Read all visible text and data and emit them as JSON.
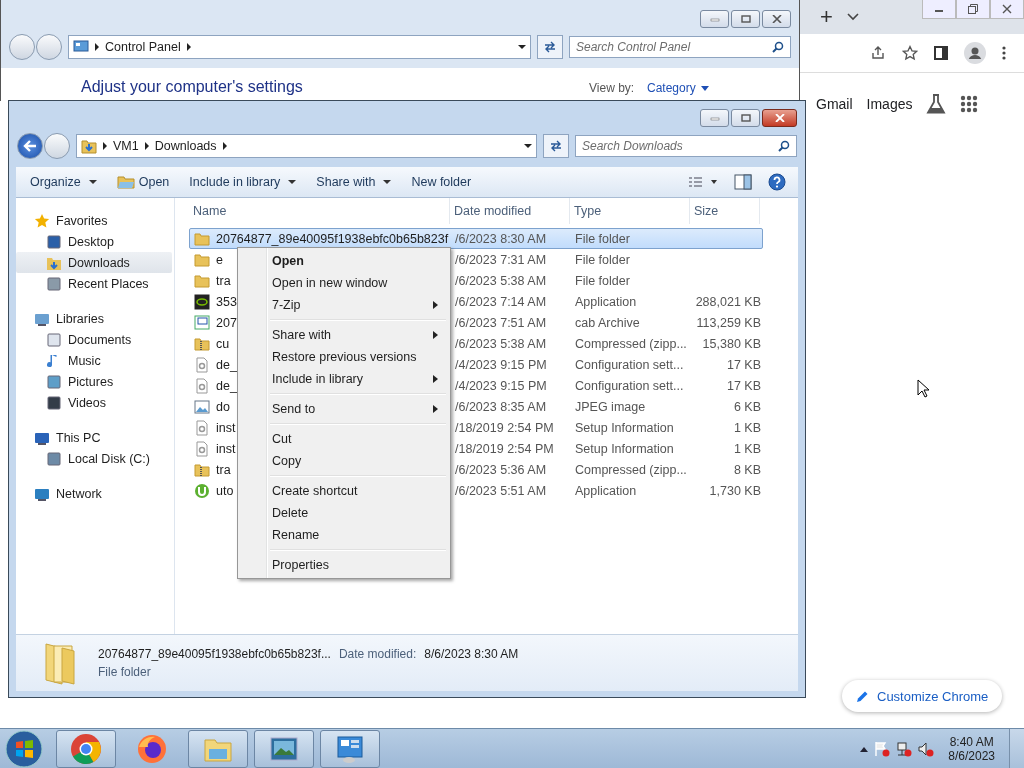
{
  "chrome": {
    "new_tab": "+",
    "links": [
      "Gmail",
      "Images"
    ],
    "customize": "Customize Chrome"
  },
  "control_panel": {
    "breadcrumb": [
      "Control Panel"
    ],
    "search": {
      "placeholder": "Search Control Panel"
    },
    "heading": "Adjust your computer's settings",
    "view_by": "View by:",
    "view_value": "Category"
  },
  "explorer": {
    "breadcrumb": [
      "VM1",
      "Downloads"
    ],
    "search": {
      "placeholder": "Search Downloads"
    },
    "toolbar": [
      {
        "label": "Organize",
        "kind": "menu"
      },
      {
        "label": "Open",
        "kind": "icon"
      },
      {
        "label": "Include in library",
        "kind": "menu"
      },
      {
        "label": "Share with",
        "kind": "menu"
      },
      {
        "label": "New folder",
        "kind": "plain"
      }
    ],
    "nav": [
      {
        "label": "Favorites",
        "kind": "star",
        "selected": false,
        "children": [
          {
            "label": "Desktop",
            "kind": "desktop",
            "selected": false
          },
          {
            "label": "Downloads",
            "kind": "downloads",
            "selected": true
          },
          {
            "label": "Recent Places",
            "kind": "recent",
            "selected": false
          }
        ]
      },
      {
        "label": "Libraries",
        "kind": "library",
        "selected": false,
        "children": [
          {
            "label": "Documents",
            "kind": "document",
            "selected": false
          },
          {
            "label": "Music",
            "kind": "music",
            "selected": false
          },
          {
            "label": "Pictures",
            "kind": "pictures",
            "selected": false
          },
          {
            "label": "Videos",
            "kind": "videos",
            "selected": false
          }
        ]
      },
      {
        "label": "This PC",
        "kind": "pc",
        "selected": false,
        "children": [
          {
            "label": "Local Disk (C:)",
            "kind": "disk",
            "selected": false
          }
        ]
      },
      {
        "label": "Network",
        "kind": "network",
        "selected": false
      }
    ],
    "columns": [
      "Name",
      "Date modified",
      "Type",
      "Size"
    ],
    "rows": [
      {
        "kind": "folder",
        "name": "20764877_89e40095f1938ebfc0b65b823f",
        "date": "/6/2023 8:30 AM",
        "type": "File folder",
        "size": "",
        "selected": true
      },
      {
        "kind": "folder",
        "name": "e",
        "date": "/6/2023 7:31 AM",
        "type": "File folder",
        "size": "",
        "selected": false
      },
      {
        "kind": "folder",
        "name": "tra",
        "date": "/6/2023 5:38 AM",
        "type": "File folder",
        "size": "",
        "selected": false
      },
      {
        "kind": "app",
        "name": "353",
        "date": "/6/2023 7:14 AM",
        "type": "Application",
        "size": "288,021 KB",
        "selected": false
      },
      {
        "kind": "cab",
        "name": "207",
        "date": "/6/2023 7:51 AM",
        "type": "cab Archive",
        "size": "113,259 KB",
        "selected": false
      },
      {
        "kind": "zip",
        "name": "cu",
        "date": "/6/2023 5:38 AM",
        "type": "Compressed (zipp...",
        "size": "15,380 KB",
        "selected": false
      },
      {
        "kind": "config",
        "name": "de_",
        "date": "/4/2023 9:15 PM",
        "type": "Configuration sett...",
        "size": "17 KB",
        "selected": false
      },
      {
        "kind": "config",
        "name": "de_",
        "date": "/4/2023 9:15 PM",
        "type": "Configuration sett...",
        "size": "17 KB",
        "selected": false
      },
      {
        "kind": "image",
        "name": "do",
        "date": "/6/2023 8:35 AM",
        "type": "JPEG image",
        "size": "6 KB",
        "selected": false
      },
      {
        "kind": "config",
        "name": "inst",
        "date": "/18/2019 2:54 PM",
        "type": "Setup Information",
        "size": "1 KB",
        "selected": false
      },
      {
        "kind": "config",
        "name": "inst",
        "date": "/18/2019 2:54 PM",
        "type": "Setup Information",
        "size": "1 KB",
        "selected": false
      },
      {
        "kind": "zip",
        "name": "tra",
        "date": "/6/2023 5:36 AM",
        "type": "Compressed (zipp...",
        "size": "8 KB",
        "selected": false
      },
      {
        "kind": "torrent",
        "name": "uto",
        "date": "/6/2023 5:51 AM",
        "type": "Application",
        "size": "1,730 KB",
        "selected": false
      }
    ],
    "details": {
      "name": "20764877_89e40095f1938ebfc0b65b823f...",
      "date_label": "Date modified:",
      "date": "8/6/2023 8:30 AM",
      "type": "File folder"
    }
  },
  "context_menu": [
    {
      "kind": "item",
      "label": "Open",
      "default": true,
      "submenu": false
    },
    {
      "kind": "item",
      "label": "Open in new window",
      "default": false,
      "submenu": false
    },
    {
      "kind": "item",
      "label": "7-Zip",
      "default": false,
      "submenu": true
    },
    {
      "kind": "separator"
    },
    {
      "kind": "item",
      "label": "Share with",
      "default": false,
      "submenu": true
    },
    {
      "kind": "item",
      "label": "Restore previous versions",
      "default": false,
      "submenu": false
    },
    {
      "kind": "item",
      "label": "Include in library",
      "default": false,
      "submenu": true
    },
    {
      "kind": "separator"
    },
    {
      "kind": "item",
      "label": "Send to",
      "default": false,
      "submenu": true
    },
    {
      "kind": "separator"
    },
    {
      "kind": "item",
      "label": "Cut",
      "default": false,
      "submenu": false
    },
    {
      "kind": "item",
      "label": "Copy",
      "default": false,
      "submenu": false
    },
    {
      "kind": "separator"
    },
    {
      "kind": "item",
      "label": "Create shortcut",
      "default": false,
      "submenu": false
    },
    {
      "kind": "item",
      "label": "Delete",
      "default": false,
      "submenu": false
    },
    {
      "kind": "item",
      "label": "Rename",
      "default": false,
      "submenu": false
    },
    {
      "kind": "separator"
    },
    {
      "kind": "item",
      "label": "Properties",
      "default": false,
      "submenu": false
    }
  ],
  "taskbar": {
    "apps": [
      {
        "kind": "chrome",
        "running": true
      },
      {
        "kind": "firefox",
        "running": false
      },
      {
        "kind": "explorer",
        "running": true
      },
      {
        "kind": "photos",
        "running": true
      },
      {
        "kind": "control",
        "running": true
      }
    ],
    "time": "8:40 AM",
    "date": "8/6/2023"
  }
}
